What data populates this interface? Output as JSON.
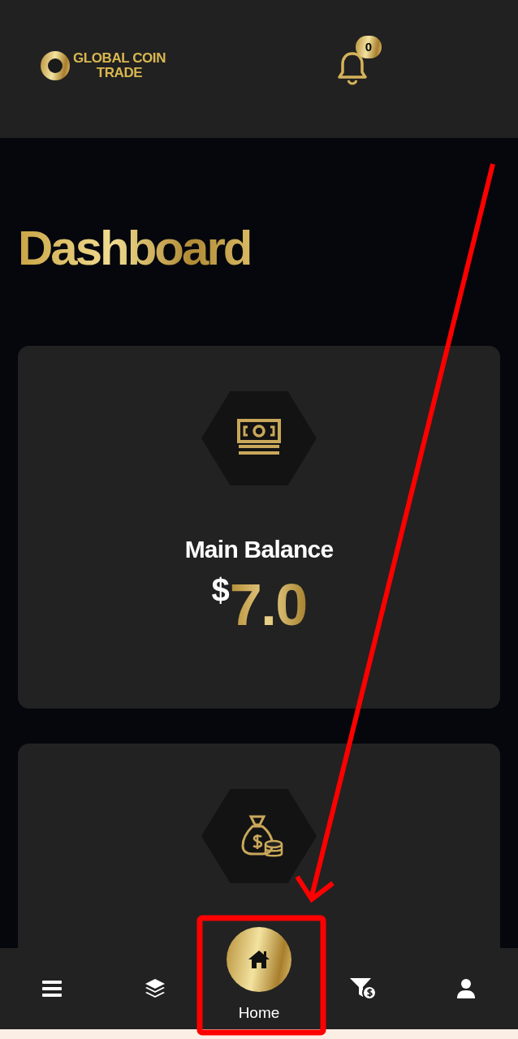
{
  "header": {
    "logo_line_1": "GLOBAL COIN",
    "logo_line_2": "TRADE",
    "notifications": "0"
  },
  "title": "Dashboard",
  "cards": [
    {
      "kind": "cash",
      "label": "Main Balance",
      "currency": "$",
      "amount": "7.0"
    },
    {
      "kind": "bag"
    }
  ],
  "nav": [
    {
      "kind": "menu",
      "selected": false
    },
    {
      "kind": "layers",
      "selected": false
    },
    {
      "kind": "home",
      "label": "Home",
      "selected": true
    },
    {
      "kind": "funnel",
      "selected": false
    },
    {
      "kind": "user",
      "selected": false
    }
  ]
}
